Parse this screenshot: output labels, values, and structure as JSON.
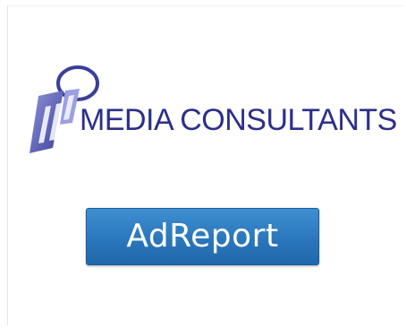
{
  "brand": {
    "logo_icon": "media-consultants-m-logo-icon",
    "name": "MEDIA CONSULTANTS",
    "color": "#2b2f8a"
  },
  "action": {
    "label": "AdReport",
    "color": "#2b77bc"
  }
}
